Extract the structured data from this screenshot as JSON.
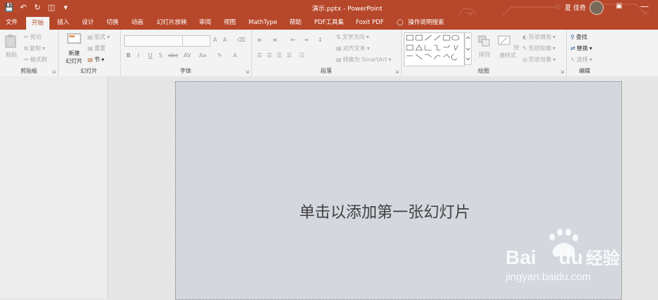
{
  "window": {
    "title": "演示.pptx  -  PowerPoint",
    "user": "夏 佳奇"
  },
  "qat": [
    "save-icon",
    "undo-icon",
    "redo-icon",
    "slideshow-icon",
    "customize-icon"
  ],
  "tabs": [
    {
      "label": "文件"
    },
    {
      "label": "开始"
    },
    {
      "label": "插入"
    },
    {
      "label": "设计"
    },
    {
      "label": "切换"
    },
    {
      "label": "动画"
    },
    {
      "label": "幻灯片放映"
    },
    {
      "label": "审阅"
    },
    {
      "label": "视图"
    },
    {
      "label": "MathType"
    },
    {
      "label": "帮助"
    },
    {
      "label": "PDF工具集"
    },
    {
      "label": "Foxit PDF"
    },
    {
      "label": "操作说明搜索"
    }
  ],
  "clipboard": {
    "paste": "粘贴",
    "cut": "剪切",
    "copy": "复制",
    "format_painter": "格式刷",
    "label": "剪贴板"
  },
  "slides": {
    "new_slide_1": "新建",
    "new_slide_2": "幻灯片",
    "layout": "版式",
    "reset": "重置",
    "section": "节",
    "label": "幻灯片"
  },
  "font": {
    "label": "字体",
    "bold": "B",
    "italic": "I",
    "underline": "U",
    "shadow": "S",
    "strike": "abc",
    "spacing": "AV",
    "case": "Aa",
    "grow": "A",
    "shrink": "A",
    "clear": "A",
    "color": "A"
  },
  "paragraph": {
    "text_direction": "文字方向",
    "align_text": "对齐文本",
    "smartart": "转换为 SmartArt",
    "label": "段落"
  },
  "drawing": {
    "arrange": "排列",
    "quick_styles": "快速样式",
    "shape_fill": "形状填充",
    "shape_outline": "形状轮廓",
    "shape_effects": "形状效果",
    "label": "绘图"
  },
  "editing": {
    "find": "查找",
    "replace": "替换",
    "select": "选择",
    "label": "编辑"
  },
  "slide_placeholder": "单击以添加第一张幻灯片",
  "watermark": {
    "brand": "Bai",
    "brand2": "du",
    "cn": "经验",
    "url": "jingyan.baidu.com"
  },
  "colors": {
    "accent": "#b7472a",
    "ribbon": "#f3f3f3",
    "slide": "#d4d7de"
  }
}
